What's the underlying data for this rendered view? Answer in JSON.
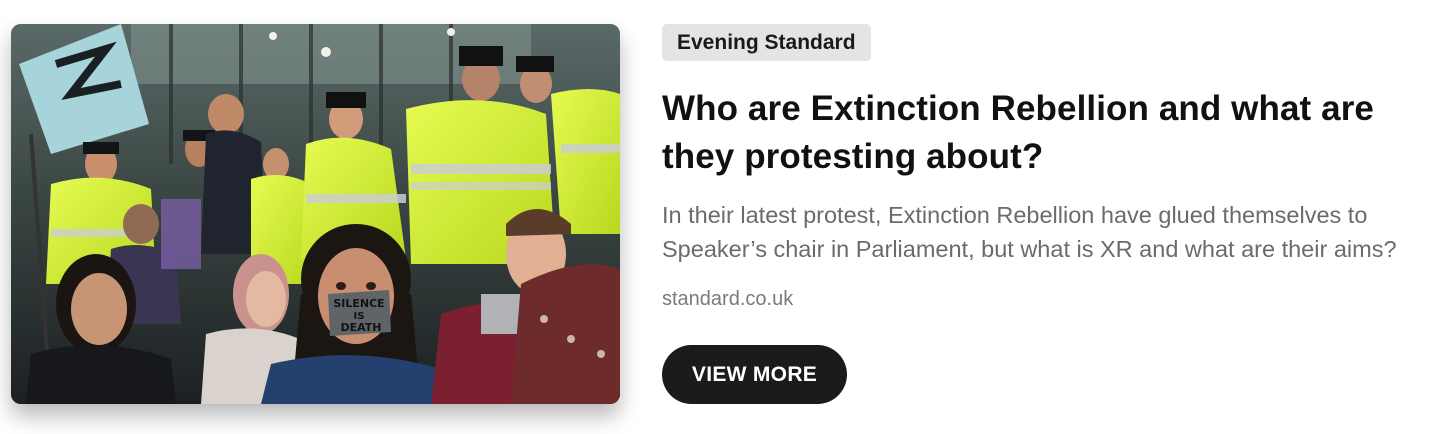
{
  "card": {
    "source": "Evening Standard",
    "headline": "Who are Extinction Rebellion and what are they protesting about?",
    "description": "In their latest protest, Extinction Rebellion have glued themselves to Speaker’s chair in Parliament, but what is XR and what are their aims?",
    "domain": "standard.co.uk",
    "button_label": "VIEW MORE"
  },
  "image": {
    "tape_text_1": "SILENCE",
    "tape_text_2": "IS",
    "tape_text_3": "DEATH"
  },
  "colors": {
    "badge_bg": "#e4e4e4",
    "button_bg": "#1b1b1b",
    "hi_vis": "#d7f23a",
    "flag": "#a7d3db"
  }
}
